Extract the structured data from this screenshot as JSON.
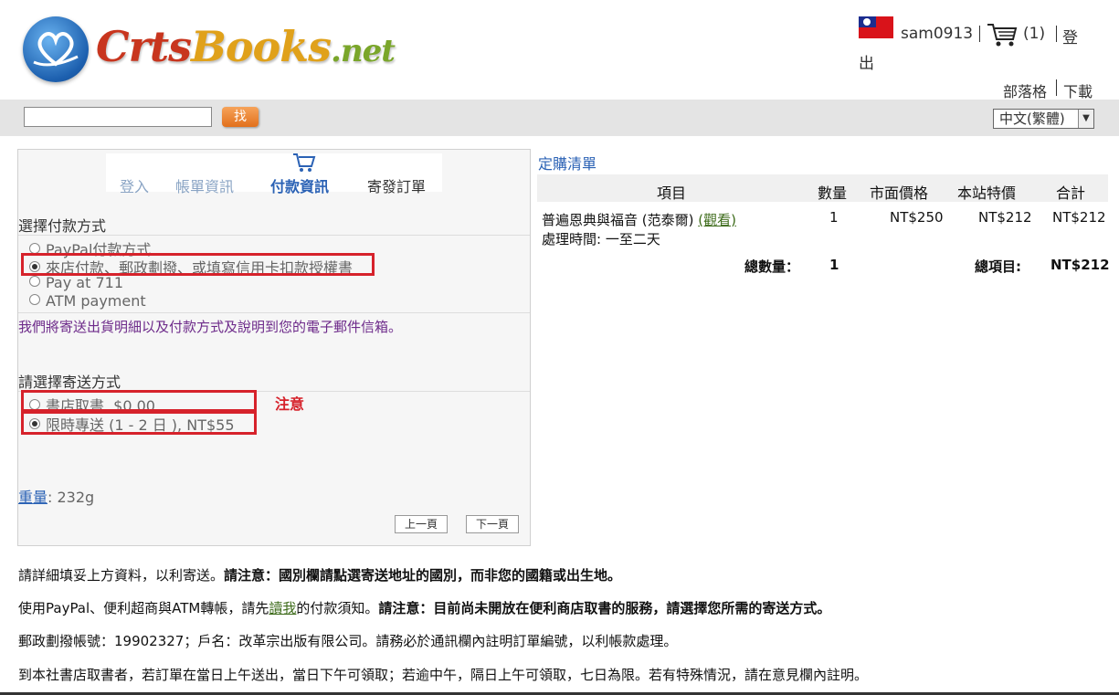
{
  "header": {
    "logo_text_a": "Crts",
    "logo_text_b": "Books",
    "logo_text_c": ".net",
    "username": "sam0913",
    "cart_count": "(1)",
    "logout_a": "登",
    "logout_b": "出",
    "blog": "部落格",
    "download": "下載"
  },
  "search": {
    "button": "找",
    "language": "中文(繁體)"
  },
  "steps": {
    "login": "登入",
    "account": "帳單資訊",
    "payment": "付款資訊",
    "send": "寄發訂單"
  },
  "payment": {
    "title": "選擇付款方式",
    "options": [
      "PayPal付款方式",
      "來店付款、郵政劃撥、或填寫信用卡扣款授權書",
      "Pay at 711",
      "ATM payment"
    ],
    "email_note": "我們將寄送出貨明細以及付款方式及說明到您的電子郵件信箱。"
  },
  "shipping": {
    "title": "請選擇寄送方式",
    "options": [
      "書店取書, $0.00",
      "限時專送 (1 - 2 日 ), NT$55"
    ],
    "note": "注意"
  },
  "weight": {
    "label": "重量",
    "value": ": 232g"
  },
  "nav": {
    "prev": "上一頁",
    "next": "下一頁"
  },
  "order": {
    "title": "定購清單",
    "headers": [
      "項目",
      "數量",
      "市面價格",
      "本站特價",
      "合計"
    ],
    "item_name": "普遍恩典與福音 (范泰爾)",
    "item_view": "(觀看)",
    "item_process": "處理時間: 一至二天",
    "qty": "1",
    "market_price": "NT$250",
    "site_price": "NT$212",
    "subtotal": "NT$212",
    "total_qty_label": "總數量：",
    "total_qty": "1",
    "total_label": "總項目:",
    "total": "NT$212"
  },
  "notes": {
    "p1_a": "請詳細填妥上方資料，以利寄送。",
    "p1_b": "請注意：國別欄請點選寄送地址的國別，而非您的國籍或出生地。",
    "p2_a": "使用PayPal、便利超商與ATM轉帳，請先",
    "p2_link": "讀我",
    "p2_b": "的付款須知。",
    "p2_c": "請注意：目前尚未開放在便利商店取書的服務，請選擇您所需的寄送方式。",
    "p3": "郵政劃撥帳號：19902327；戶名：改革宗出版有限公司。請務必於通訊欄內註明訂單編號，以利帳款處理。",
    "p4": "到本社書店取書者，若訂單在當日上午送出，當日下午可領取；若逾中午，隔日上午可領取，七日為限。若有特殊情況，請在意見欄內註明。"
  }
}
